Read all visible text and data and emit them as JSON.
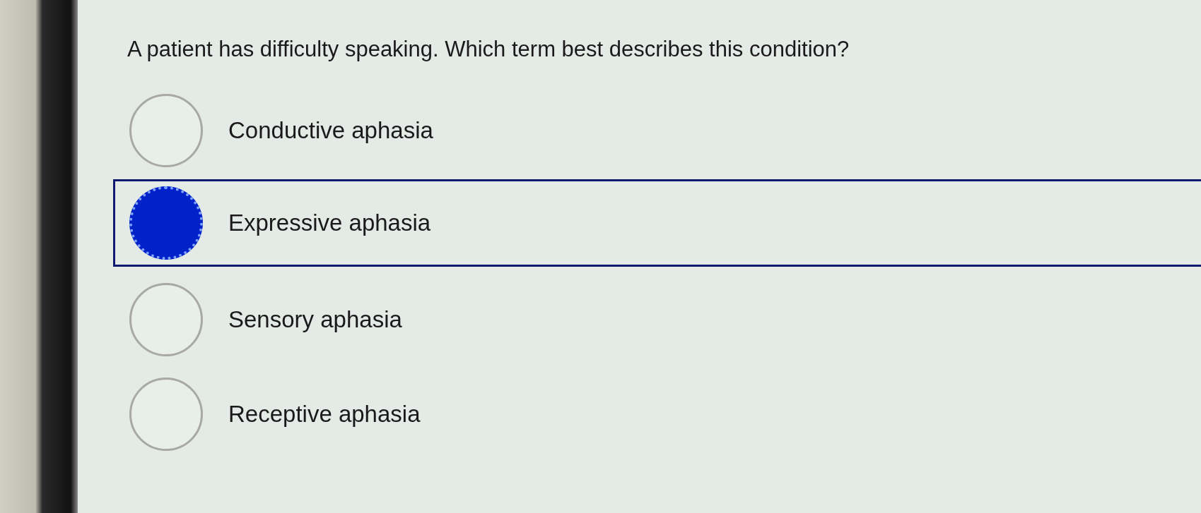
{
  "question": "A patient has difficulty speaking. Which term best describes this condition?",
  "options": [
    {
      "label": "Conductive aphasia",
      "selected": false
    },
    {
      "label": "Expressive aphasia",
      "selected": true
    },
    {
      "label": "Sensory aphasia",
      "selected": false
    },
    {
      "label": "Receptive aphasia",
      "selected": false
    }
  ]
}
